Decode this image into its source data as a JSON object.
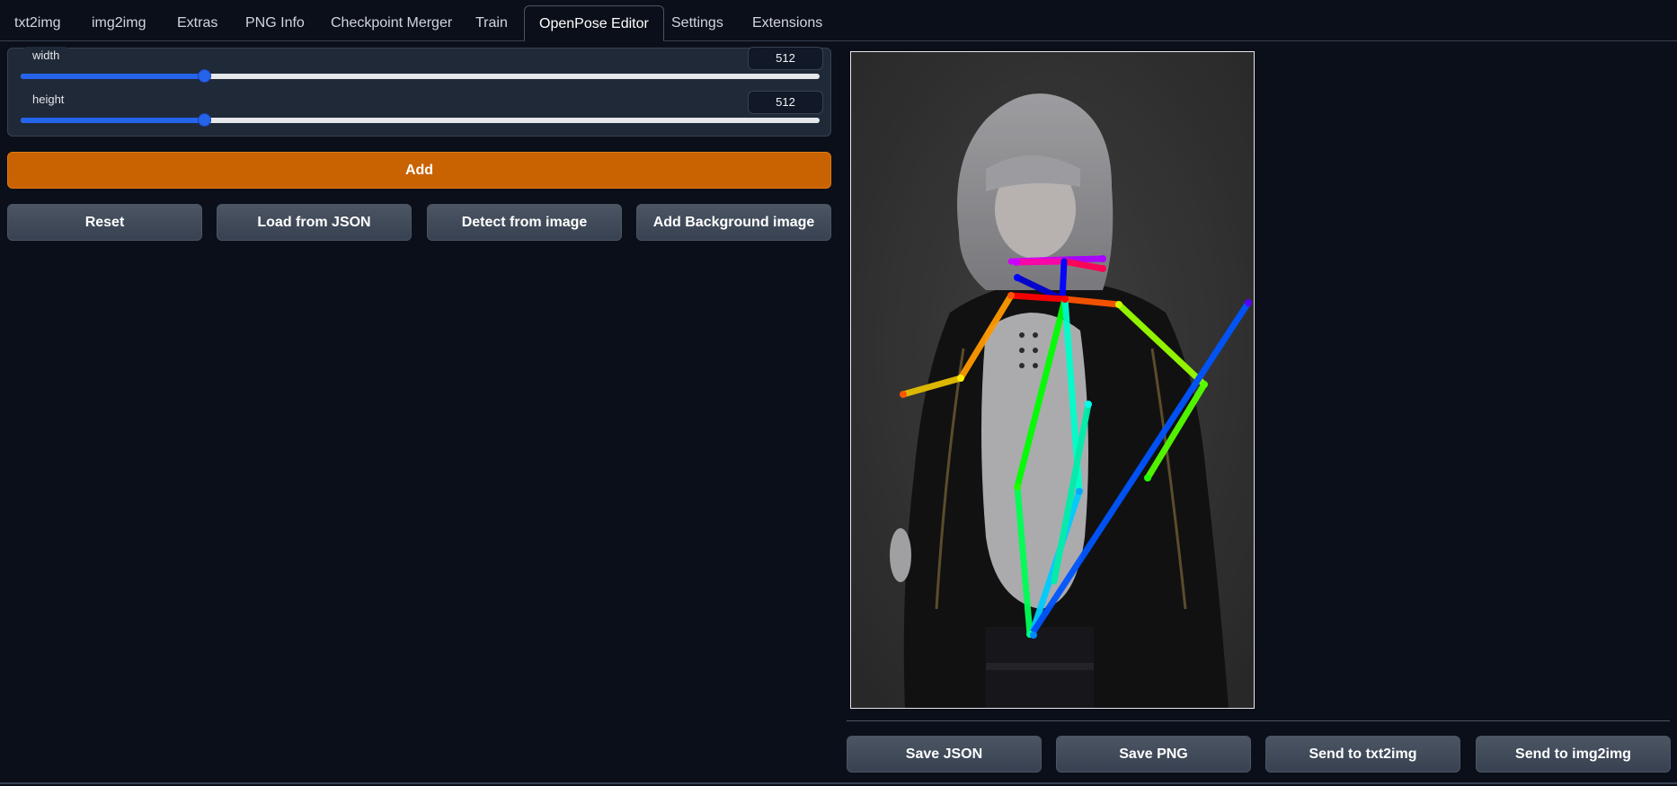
{
  "tabs": [
    {
      "label": "txt2img",
      "active": false
    },
    {
      "label": "img2img",
      "active": false
    },
    {
      "label": "Extras",
      "active": false
    },
    {
      "label": "PNG Info",
      "active": false
    },
    {
      "label": "Checkpoint Merger",
      "active": false
    },
    {
      "label": "Train",
      "active": false
    },
    {
      "label": "OpenPose Editor",
      "active": true
    },
    {
      "label": "Settings",
      "active": false
    },
    {
      "label": "Extensions",
      "active": false
    }
  ],
  "sliders": {
    "width": {
      "label": "width",
      "value": "512",
      "fraction": 0.23
    },
    "height": {
      "label": "height",
      "value": "512",
      "fraction": 0.23
    }
  },
  "buttons": {
    "add": "Add",
    "reset": "Reset",
    "load_json": "Load from JSON",
    "detect": "Detect from image",
    "add_background": "Add Background image",
    "save_json": "Save JSON",
    "save_png": "Save PNG",
    "send_txt2img": "Send to txt2img",
    "send_img2img": "Send to img2img"
  },
  "colors": {
    "accent_orange": "#c96200",
    "slider_blue": "#2563eb",
    "background": "#0b0f19"
  },
  "canvas": {
    "pose_icon": "openpose-skeleton",
    "background_image": "anime-figure-photo"
  }
}
